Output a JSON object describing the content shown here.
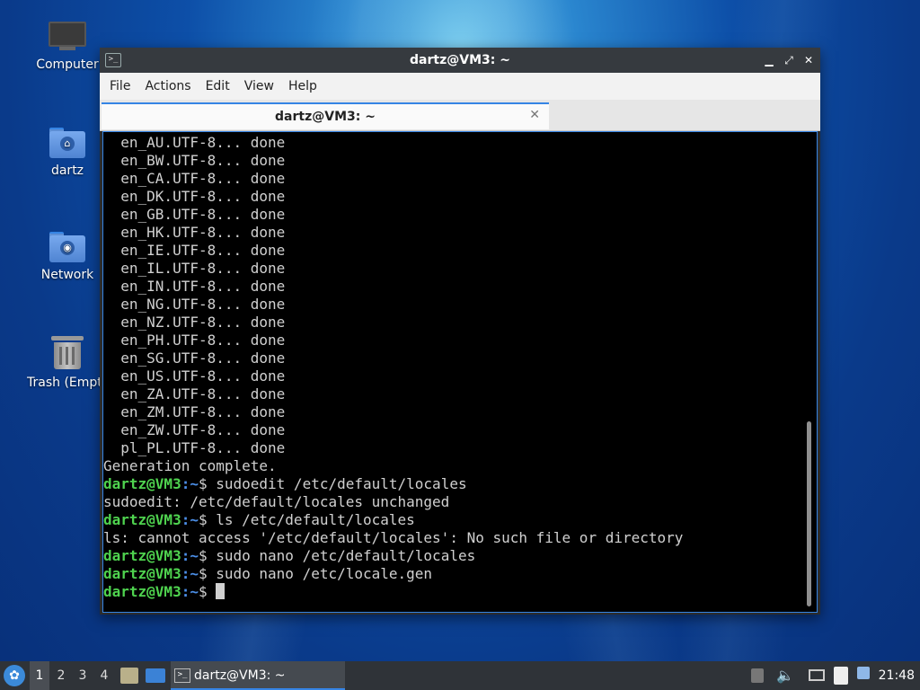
{
  "desktop": {
    "icons": [
      {
        "label": "Computer"
      },
      {
        "label": "dartz"
      },
      {
        "label": "Network"
      },
      {
        "label": "Trash (Empty)"
      }
    ]
  },
  "window": {
    "title": "dartz@VM3: ~",
    "app_icon": ">_",
    "controls": {
      "minimize": "▁",
      "maximize": "⤢",
      "close": "✕"
    },
    "menu": [
      "File",
      "Actions",
      "Edit",
      "View",
      "Help"
    ],
    "tab": {
      "title": "dartz@VM3: ~",
      "close": "✕"
    }
  },
  "terminal": {
    "prompt_user": "dartz@VM3",
    "prompt_path": ":~",
    "prompt_symbol": "$ ",
    "output_lines": [
      "  en_AU.UTF-8... done",
      "  en_BW.UTF-8... done",
      "  en_CA.UTF-8... done",
      "  en_DK.UTF-8... done",
      "  en_GB.UTF-8... done",
      "  en_HK.UTF-8... done",
      "  en_IE.UTF-8... done",
      "  en_IL.UTF-8... done",
      "  en_IN.UTF-8... done",
      "  en_NG.UTF-8... done",
      "  en_NZ.UTF-8... done",
      "  en_PH.UTF-8... done",
      "  en_SG.UTF-8... done",
      "  en_US.UTF-8... done",
      "  en_ZA.UTF-8... done",
      "  en_ZM.UTF-8... done",
      "  en_ZW.UTF-8... done",
      "  pl_PL.UTF-8... done",
      "Generation complete."
    ],
    "session": [
      {
        "type": "cmd",
        "text": "sudoedit /etc/default/locales"
      },
      {
        "type": "out",
        "text": "sudoedit: /etc/default/locales unchanged"
      },
      {
        "type": "cmd",
        "text": "ls /etc/default/locales"
      },
      {
        "type": "out",
        "text": "ls: cannot access '/etc/default/locales': No such file or directory"
      },
      {
        "type": "cmd",
        "text": "sudo nano /etc/default/locales"
      },
      {
        "type": "cmd",
        "text": "sudo nano /etc/locale.gen"
      },
      {
        "type": "cmd",
        "text": ""
      }
    ]
  },
  "taskbar": {
    "workspaces": [
      "1",
      "2",
      "3",
      "4"
    ],
    "active_workspace": "1",
    "task": {
      "label": "dartz@VM3: ~",
      "icon": ">_"
    },
    "clock": "21:48"
  }
}
